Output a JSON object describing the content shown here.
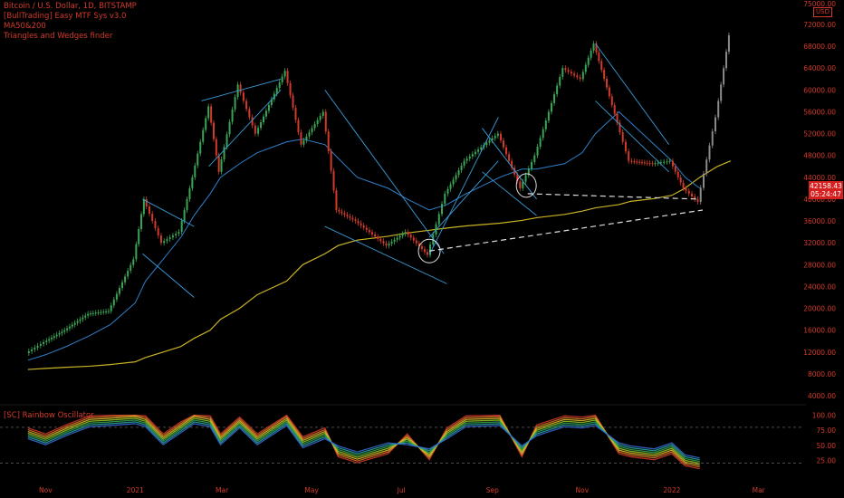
{
  "legend": {
    "symbol": "Bitcoin / U.S. Dollar, 1D, BITSTAMP",
    "indicator1": "[BullTrading] Easy MTF Sys v3.0",
    "indicator2": "MA50&200",
    "indicator3": "Triangles and Wedges finder"
  },
  "oscillator": {
    "label": "[SC] Rainbow Oscillator"
  },
  "price_axis": {
    "unit": "USD",
    "top_value": "75000.00"
  },
  "last_price": {
    "value": "42158.43",
    "countdown": "05:24:47"
  },
  "colors": {
    "background": "#000000",
    "text": "#d23a2a",
    "ma200": "#c9b325",
    "ma50": "#2f7fc9",
    "up": "#3aa655",
    "down": "#d23a2a",
    "pattern": "#3a9bd9",
    "price_tag": "#d61f1f"
  },
  "chart_data": {
    "type": "line",
    "title": "Bitcoin / U.S. Dollar, 1D, BITSTAMP",
    "y_scale": "log",
    "ylim": [
      4000,
      75000
    ],
    "yticks": [
      "72000.00",
      "68000.00",
      "64000.00",
      "60000.00",
      "56000.00",
      "52000.00",
      "48000.00",
      "44000.00",
      "40000.00",
      "36000.00",
      "32000.00",
      "28000.00",
      "24000.00",
      "20000.00",
      "16000.00",
      "12000.00",
      "8000.00",
      "4000.00"
    ],
    "x_ticks": [
      "Nov",
      "2021",
      "Mar",
      "May",
      "Jul",
      "Sep",
      "Nov",
      "2022",
      "Mar"
    ],
    "osc_ticks": [
      "100.00",
      "75.00",
      "50.00",
      "25.00"
    ],
    "series": [
      {
        "type": "candles",
        "dates": [
          "2020-10-20",
          "2020-11-01",
          "2020-11-15",
          "2020-12-01",
          "2020-12-15",
          "2021-01-01",
          "2021-01-08",
          "2021-01-20",
          "2021-02-01",
          "2021-02-10",
          "2021-02-21",
          "2021-02-28",
          "2021-03-13",
          "2021-03-25",
          "2021-04-14",
          "2021-04-25",
          "2021-05-10",
          "2021-05-19",
          "2021-06-01",
          "2021-06-22",
          "2021-07-05",
          "2021-07-20",
          "2021-08-01",
          "2021-08-14",
          "2021-09-06",
          "2021-09-21",
          "2021-10-01",
          "2021-10-20",
          "2021-11-01",
          "2021-11-10",
          "2021-11-26",
          "2021-12-04",
          "2021-12-20",
          "2022-01-01",
          "2022-01-10",
          "2022-01-20",
          "2022-02-01",
          "2022-02-10"
        ],
        "values": [
          11800,
          13800,
          16000,
          19000,
          19500,
          29000,
          40000,
          32000,
          34000,
          44000,
          57000,
          45000,
          61000,
          52000,
          63500,
          50000,
          56000,
          38000,
          36000,
          31500,
          34000,
          29800,
          41000,
          47000,
          52000,
          42000,
          48000,
          64000,
          62000,
          68500,
          54000,
          47000,
          46500,
          47000,
          42000,
          39500,
          55000,
          70000
        ]
      }
    ],
    "ma200_values": [
      8800,
      9000,
      9200,
      9400,
      9700,
      10200,
      11000,
      12000,
      13000,
      14500,
      16000,
      18000,
      20000,
      22500,
      25000,
      28000,
      30000,
      31500,
      32500,
      33200,
      33800,
      34300,
      34700,
      35100,
      35600,
      36100,
      36600,
      37200,
      37800,
      38400,
      39000,
      39600,
      40100,
      40700,
      42000,
      44000,
      46000,
      47000
    ],
    "ma50_values": [
      10500,
      11500,
      13000,
      15000,
      17000,
      21000,
      25000,
      29000,
      33000,
      37000,
      41000,
      44000,
      46500,
      48500,
      50500,
      51000,
      50000,
      47500,
      44000,
      42000,
      40000,
      38000,
      39000,
      41000,
      44000,
      45500,
      45500,
      46500,
      48500,
      52000,
      56000,
      54000,
      50000,
      47000,
      44000,
      42000,
      null,
      null
    ],
    "oscillator_values": [
      70,
      60,
      75,
      90,
      92,
      95,
      90,
      60,
      80,
      95,
      90,
      60,
      88,
      60,
      92,
      55,
      70,
      40,
      30,
      45,
      60,
      35,
      70,
      90,
      92,
      40,
      75,
      90,
      88,
      92,
      45,
      40,
      35,
      45,
      25,
      20,
      null,
      null
    ]
  }
}
